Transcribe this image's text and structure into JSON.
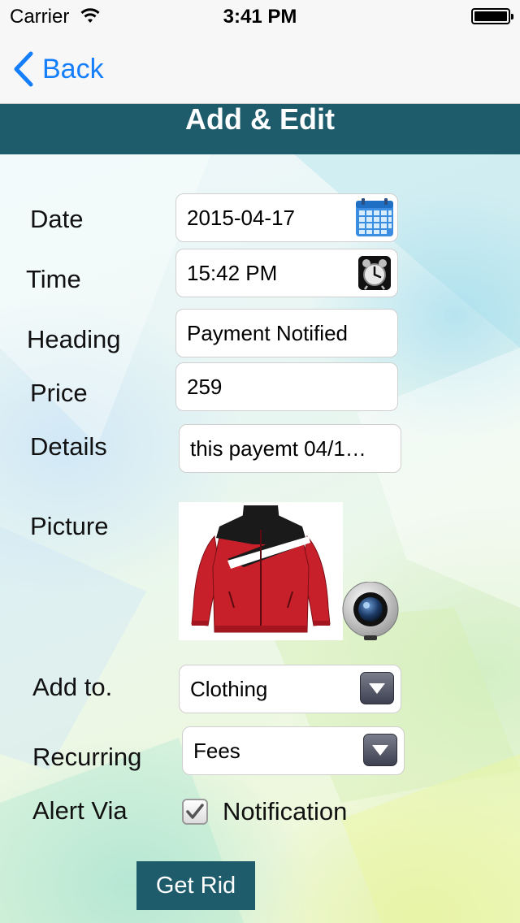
{
  "status_bar": {
    "carrier": "Carrier",
    "time": "3:41 PM"
  },
  "nav": {
    "back_label": "Back"
  },
  "header": {
    "title": "Add & Edit"
  },
  "form": {
    "date_label": "Date",
    "date_value": "2015-04-17",
    "time_label": "Time",
    "time_value": "15:42 PM",
    "heading_label": "Heading",
    "heading_value": "Payment Notified",
    "price_label": "Price",
    "price_value": "259",
    "details_label": "Details",
    "details_value": "this payemt 04/1…",
    "picture_label": "Picture",
    "picture_icon": "red-jacket-image",
    "add_to_label": "Add to.",
    "add_to_value": "Clothing",
    "recurring_label": "Recurring",
    "recurring_value": "Fees",
    "alert_label": "Alert Via",
    "alert_option_label": "Notification",
    "alert_option_checked": true
  },
  "actions": {
    "get_rid_label": "Get Rid"
  },
  "colors": {
    "accent": "#1f5c6b",
    "ios_blue": "#157efb",
    "jacket_red": "#c8202a"
  }
}
